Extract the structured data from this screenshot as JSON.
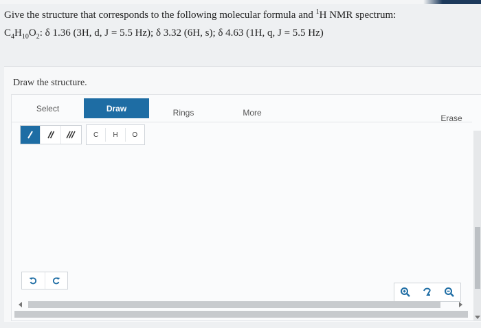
{
  "question": {
    "text": "Give the structure that corresponds to the following molecular formula and ",
    "nmr_sup": "1",
    "nmr_text": "H NMR spectrum:"
  },
  "formula": {
    "c": "C",
    "c_sub": "4",
    "h": "H",
    "h_sub": "10",
    "o": "O",
    "o_sub": "2",
    "spectrum": ": δ 1.36 (3H, d, J = 5.5 Hz); δ 3.32 (6H, s); δ 4.63 (1H, q, J = 5.5 Hz)"
  },
  "editor": {
    "prompt": "Draw the structure.",
    "tabs": {
      "select": "Select",
      "draw": "Draw",
      "rings": "Rings",
      "more": "More",
      "erase": "Erase"
    },
    "atoms": [
      "C",
      "H",
      "O"
    ],
    "bond_icons": [
      "single-bond-icon",
      "double-bond-icon",
      "triple-bond-icon"
    ],
    "active_tab": "Draw",
    "active_bond": "single"
  },
  "colors": {
    "accent": "#1e6da4",
    "background": "#eef0f2"
  }
}
